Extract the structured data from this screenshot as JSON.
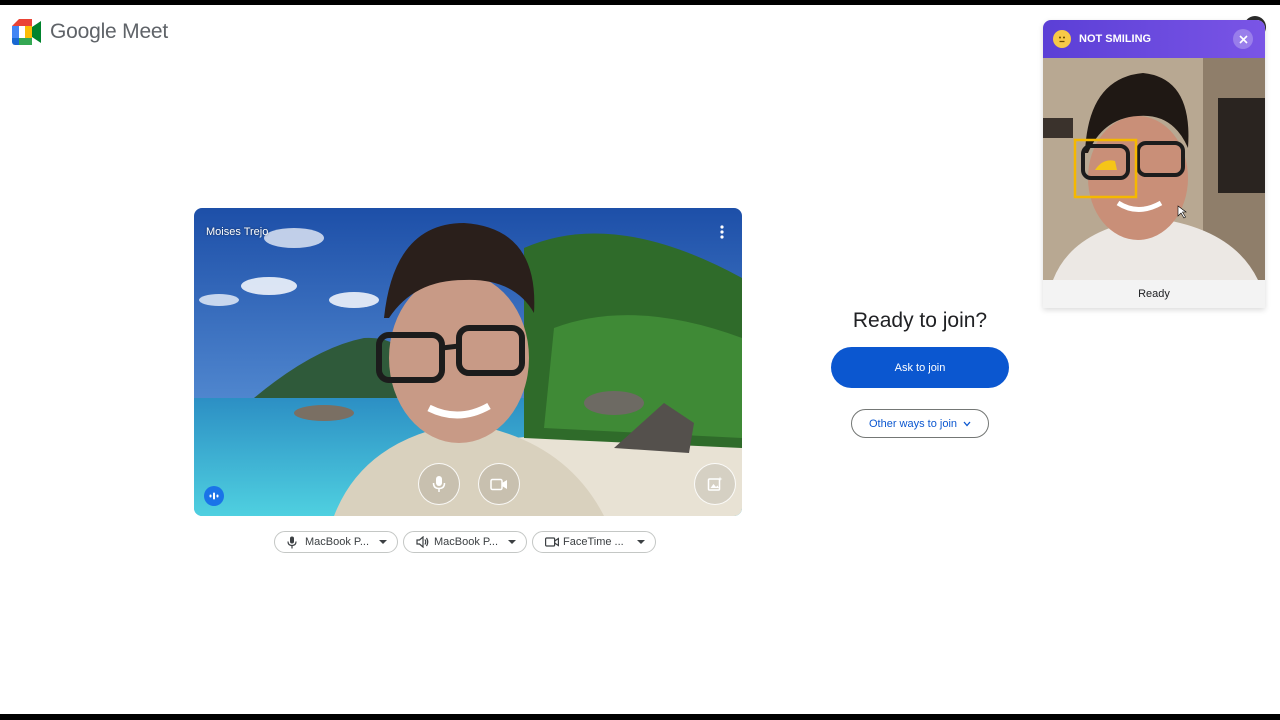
{
  "app": {
    "name": "Google Meet"
  },
  "preview": {
    "participant_name": "Moises Trejo",
    "mic_icon": "mic-icon",
    "camera_icon": "videocam-icon",
    "effects_icon": "visual-effects-icon",
    "more_icon": "more-vert-icon"
  },
  "devices": [
    {
      "icon": "mic-icon",
      "label": "MacBook P..."
    },
    {
      "icon": "speaker-icon",
      "label": "MacBook P..."
    },
    {
      "icon": "videocam-icon",
      "label": "FaceTime ..."
    }
  ],
  "join": {
    "heading": "Ready to join?",
    "ask_label": "Ask to join",
    "other_label": "Other ways to join"
  },
  "smile_panel": {
    "title": "NOT SMILING",
    "status": "Ready",
    "emoji_icon": "neutral-face-icon",
    "close_icon": "close-icon"
  },
  "colors": {
    "primary": "#0b57d0",
    "panel_header": "#6a4be0",
    "detection_box": "#f5b800"
  }
}
